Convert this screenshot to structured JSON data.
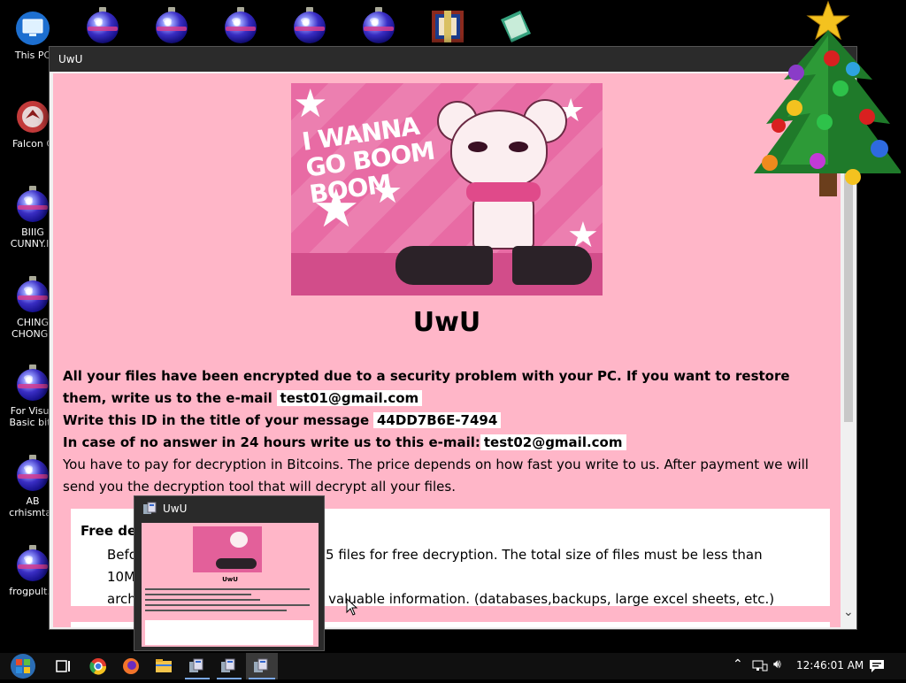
{
  "desktop": {
    "icons": [
      {
        "label": "This PC",
        "icon": "this-pc-icon"
      },
      {
        "label": "Falcon C",
        "icon": "falcon-icon"
      },
      {
        "label": "BIIIG\nCUNNY.In",
        "icon": "ornament-icon"
      },
      {
        "label": "CHING\nCHONG.I",
        "icon": "ornament-icon"
      },
      {
        "label": "For Visua\nBasic bitc",
        "icon": "ornament-icon"
      },
      {
        "label": "AB\ncrhismtas",
        "icon": "ornament-icon"
      },
      {
        "label": "frogpult.e",
        "icon": "ornament-icon"
      }
    ]
  },
  "window": {
    "title": "UwU",
    "heading": "UwU",
    "banner_text": "I WANNA GO BOOM BOOM",
    "message": {
      "line1_pre": "All your files have been encrypted due to a security problem with your PC. If you want to restore them, write us to the e-mail",
      "email1": "test01@gmail.com",
      "line2_pre": "Write this ID in the title of your message",
      "id": "44DD7B6E-7494",
      "line3_pre": "In case of no answer in 24 hours write us to this e-mail:",
      "email2": "test02@gmail.com",
      "line4": "You have to pay for decryption in Bitcoins. The price depends on how fast you write to us. After payment we will send you the decryption tool that will decrypt all your files."
    },
    "free": {
      "title": "Free decr",
      "body_a": "Before",
      "body_b": "5 files for free decryption. The total size of files must be less than 10Mb (non",
      "body_c": "archiv",
      "body_d": "n valuable information. (databases,backups, large excel sheets, etc.)"
    }
  },
  "thumbnail": {
    "title": "UwU",
    "heading": "UwU"
  },
  "taskbar": {
    "clock": "12:46:01 AM",
    "items": [
      "start-button",
      "task-view",
      "chrome",
      "firefox",
      "file-explorer",
      "app-1",
      "app-2",
      "app-3"
    ]
  },
  "colors": {
    "page_bg": "#ffb6c8",
    "banner_pink": "#e3609a",
    "taskbar": "#101010"
  }
}
